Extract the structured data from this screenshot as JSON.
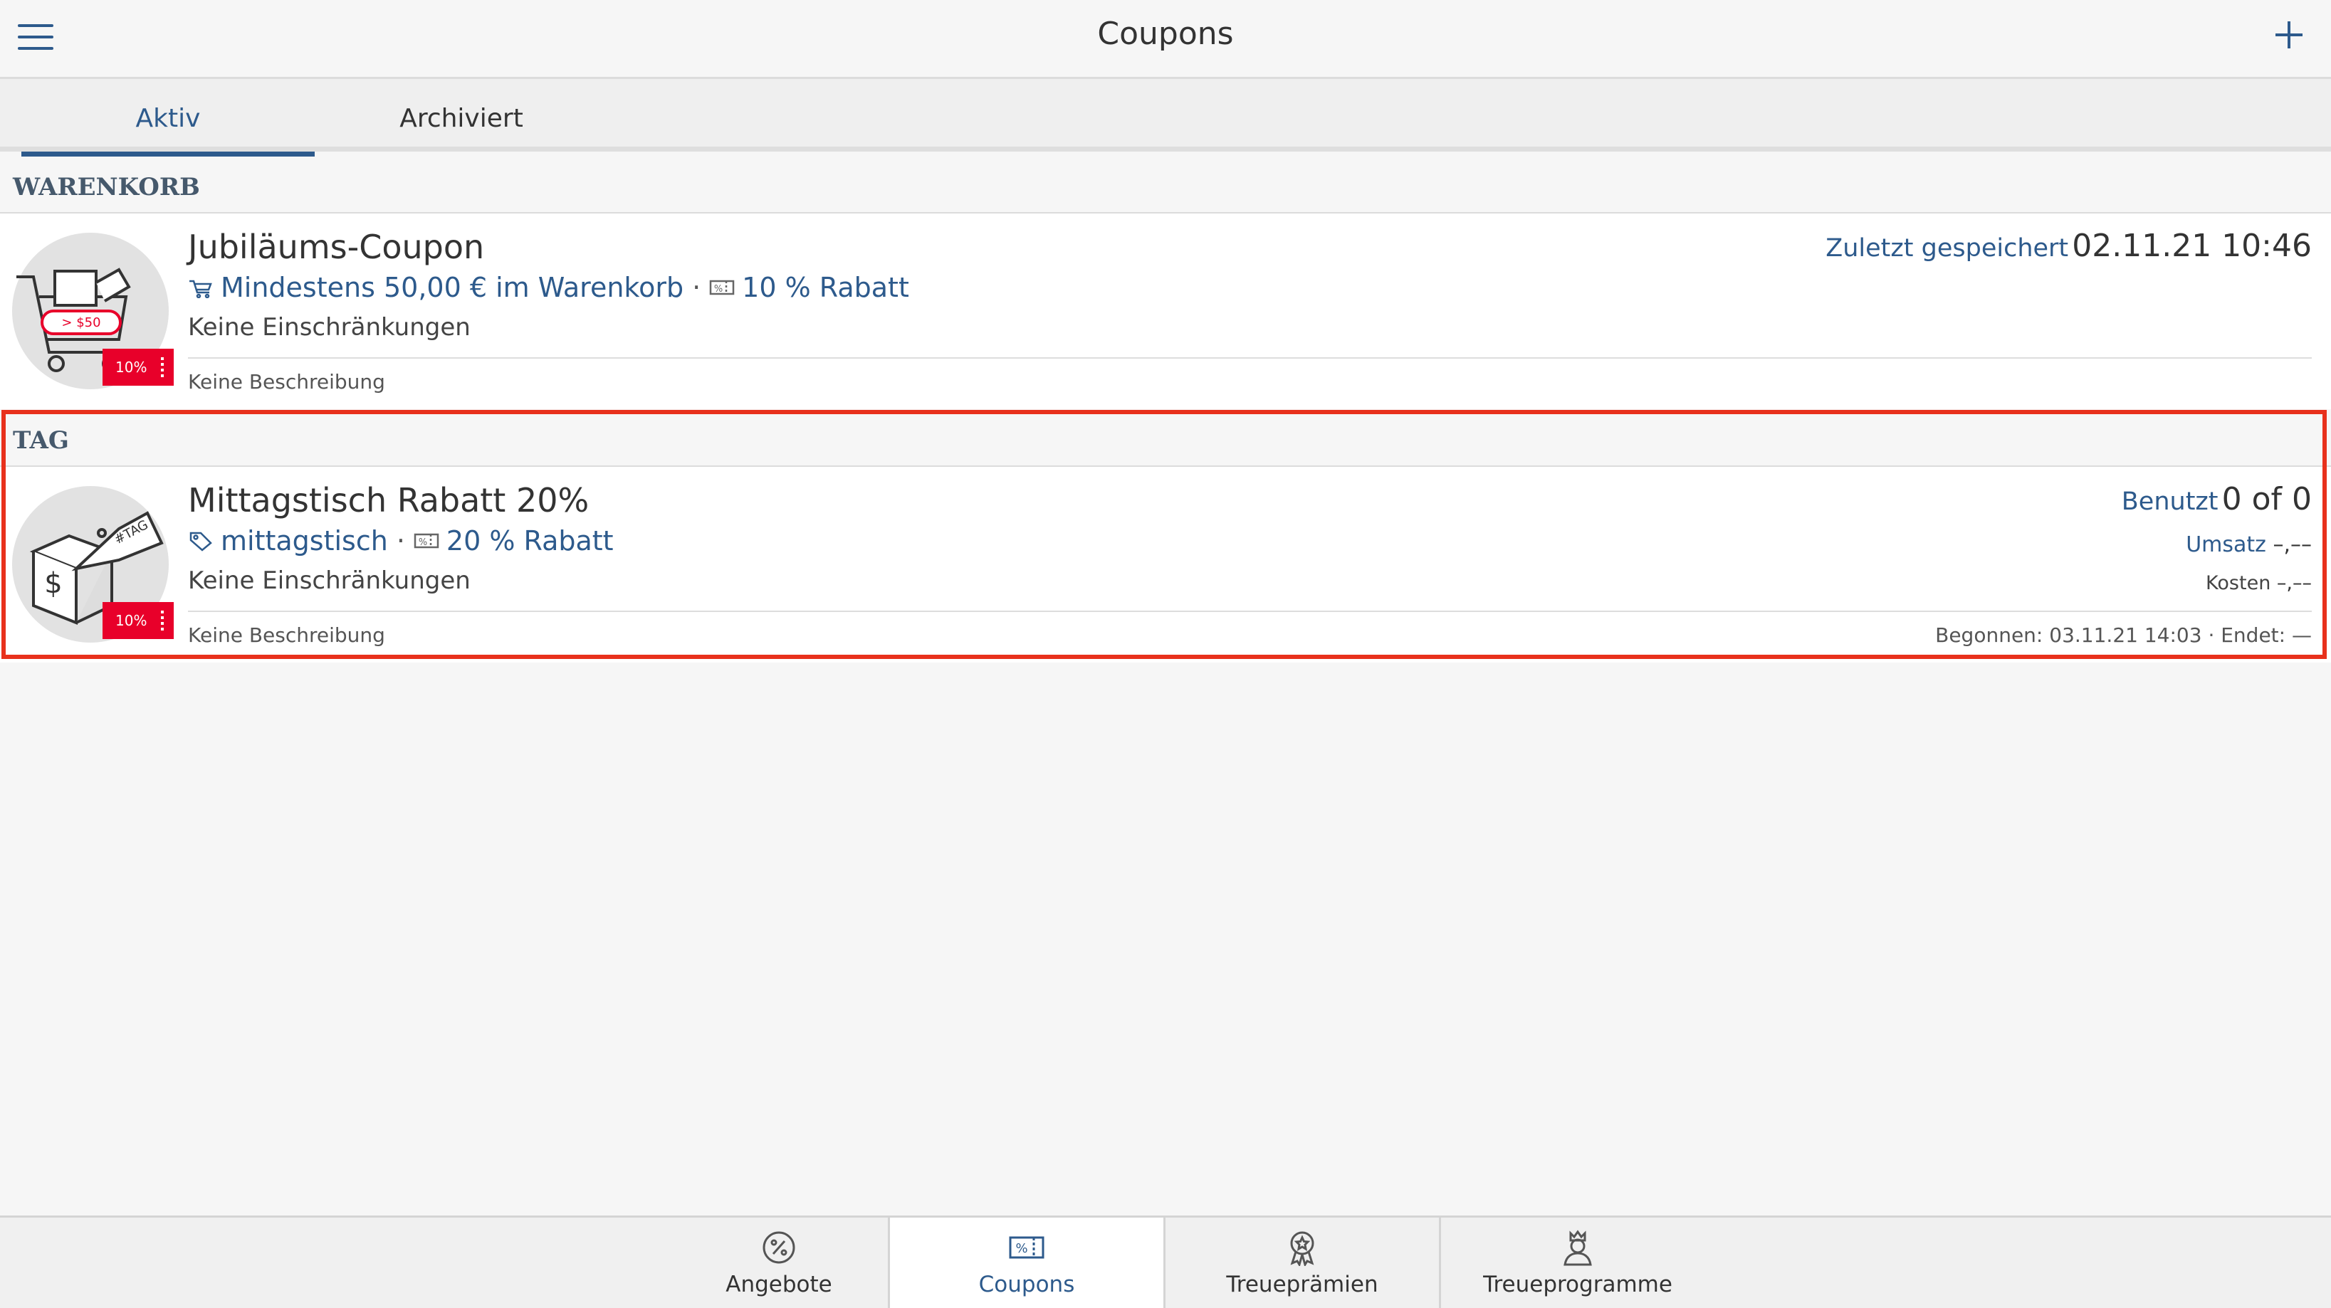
{
  "header": {
    "title": "Coupons"
  },
  "tabs": [
    {
      "label": "Aktiv"
    },
    {
      "label": "Archiviert"
    }
  ],
  "sections": [
    {
      "title": "WARENKORB",
      "coupon": {
        "name": "Jubiläums-Coupon",
        "condition": "Mindestens 50,00 € im Warenkorb",
        "discount": "10 % Rabatt",
        "restriction": "Keine Einschränkungen",
        "description": "Keine Beschreibung",
        "badge": "10%",
        "image_text": "> $50",
        "saved_label": "Zuletzt gespeichert",
        "saved_value": "02.11.21 10:46"
      }
    },
    {
      "title": "TAG",
      "coupon": {
        "name": "Mittagstisch Rabatt 20%",
        "condition": "mittagstisch",
        "discount": "20 % Rabatt",
        "restriction": "Keine Einschränkungen",
        "description": "Keine Beschreibung",
        "badge": "10%",
        "image_text": "#TAG",
        "used_label": "Benutzt",
        "used_value": "0 of 0",
        "revenue_label": "Umsatz",
        "revenue_value": "–,––",
        "cost_label": "Kosten",
        "cost_value": "–,––",
        "dates": "Begonnen: 03.11.21 14:03 · Endet: —"
      }
    }
  ],
  "bottom_nav": [
    {
      "label": "Angebote",
      "icon": "percent-badge-icon"
    },
    {
      "label": "Coupons",
      "icon": "coupon-ticket-icon"
    },
    {
      "label": "Treueprämien",
      "icon": "award-rosette-icon"
    },
    {
      "label": "Treueprogramme",
      "icon": "king-person-icon"
    }
  ],
  "colors": {
    "accent": "#2d5a8c",
    "badge": "#e8002a",
    "highlight": "#e8311c",
    "section_title": "#46596c"
  }
}
